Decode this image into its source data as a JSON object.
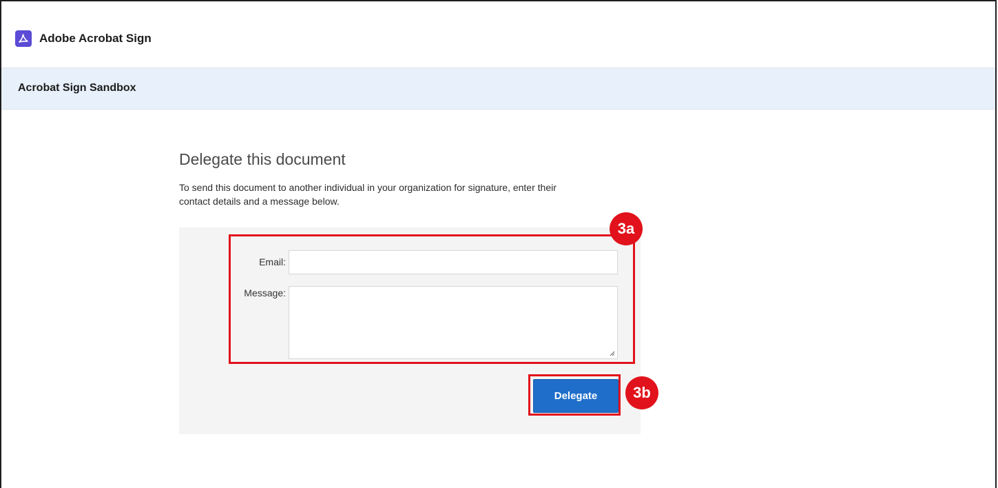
{
  "header": {
    "brand": "Adobe Acrobat Sign",
    "logo_icon": "acrobat-logo-icon",
    "accent": "#5b4bd6"
  },
  "subheader": {
    "title": "Acrobat Sign Sandbox",
    "background": "#e8f0fb"
  },
  "main": {
    "title": "Delegate this document",
    "intro_line1": "To send this document to another individual in your organization for signature, enter their",
    "intro_line2": "contact details and a message below.",
    "form": {
      "email_label": "Email:",
      "email_value": "",
      "message_label": "Message:",
      "message_value": "",
      "submit_label": "Delegate",
      "submit_color": "#1f6fca"
    }
  },
  "annotations": {
    "callout_a": "3a",
    "callout_b": "3b",
    "highlight_color": "#e1121b"
  }
}
